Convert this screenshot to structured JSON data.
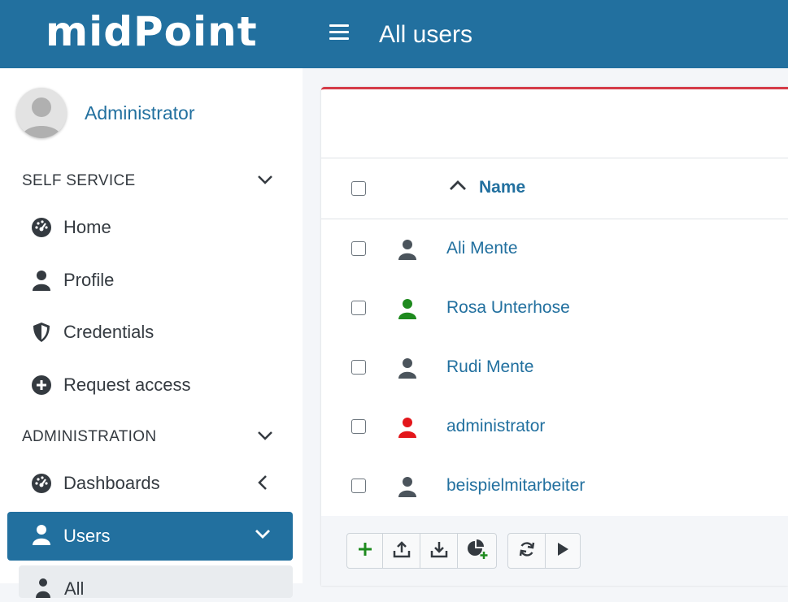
{
  "app": {
    "logo_text": "midPoint",
    "page_title": "All users"
  },
  "sidebar": {
    "user_name": "Administrator",
    "sections": [
      {
        "label": "SELF SERVICE"
      },
      {
        "label": "ADMINISTRATION"
      }
    ],
    "self_service_items": [
      {
        "label": "Home",
        "icon": "dashboard-gauge-icon"
      },
      {
        "label": "Profile",
        "icon": "user-icon"
      },
      {
        "label": "Credentials",
        "icon": "shield-icon"
      },
      {
        "label": "Request access",
        "icon": "plus-circle-icon"
      }
    ],
    "admin_items": [
      {
        "label": "Dashboards",
        "icon": "dashboard-gauge-icon"
      },
      {
        "label": "Users",
        "icon": "user-icon",
        "active": true
      }
    ],
    "sub_item_partial": "All"
  },
  "table": {
    "column_name": "Name",
    "sort": "ascending",
    "rows": [
      {
        "name": "Ali Mente",
        "icon_color": "#4b545c"
      },
      {
        "name": "Rosa Unterhose",
        "icon_color": "#1e8a1e"
      },
      {
        "name": "Rudi Mente",
        "icon_color": "#4b545c"
      },
      {
        "name": "administrator",
        "icon_color": "#e3161b"
      },
      {
        "name": "beispielmitarbeiter",
        "icon_color": "#4b545c"
      }
    ]
  },
  "footer_buttons": [
    {
      "icon": "add-icon"
    },
    {
      "icon": "import-icon"
    },
    {
      "icon": "export-icon"
    },
    {
      "icon": "report-chart-icon"
    },
    {
      "icon": "refresh-icon"
    },
    {
      "icon": "play-icon"
    }
  ],
  "colors": {
    "header": "#22709f",
    "accent_red": "#d53b48",
    "link": "#22709f"
  }
}
